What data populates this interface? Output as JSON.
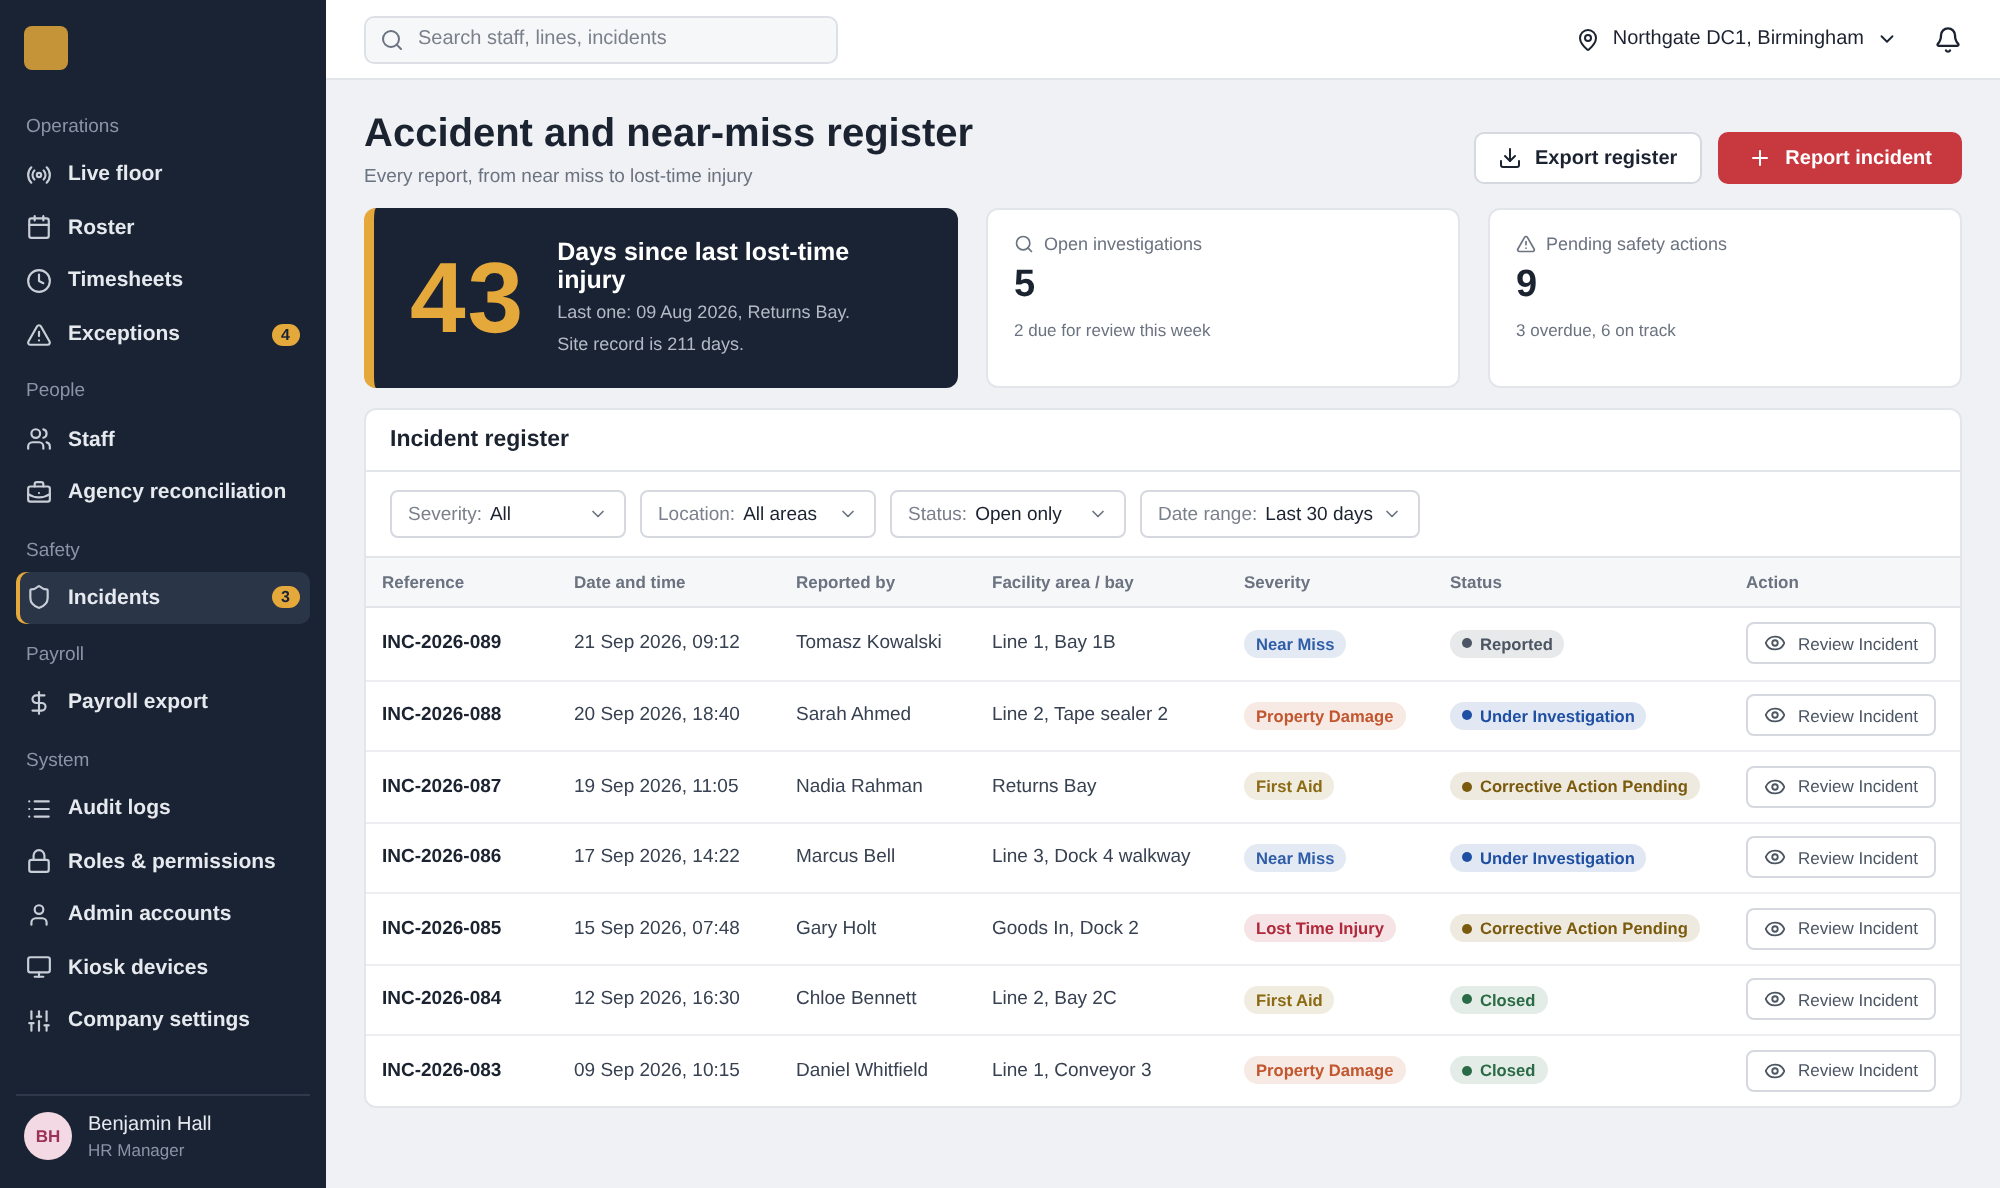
{
  "sidebar": {
    "sections": [
      {
        "title": "Operations",
        "items": [
          {
            "label": "Live floor",
            "selected": false
          },
          {
            "label": "Roster",
            "selected": false
          },
          {
            "label": "Timesheets",
            "selected": false
          },
          {
            "label": "Exceptions",
            "selected": false,
            "badge": "4"
          }
        ]
      },
      {
        "title": "People",
        "items": [
          {
            "label": "Staff",
            "selected": false
          },
          {
            "label": "Agency reconciliation",
            "selected": false
          }
        ]
      },
      {
        "title": "Safety",
        "items": [
          {
            "label": "Incidents",
            "selected": true,
            "badge": "3"
          }
        ]
      },
      {
        "title": "Payroll",
        "items": [
          {
            "label": "Payroll export",
            "selected": false
          }
        ]
      },
      {
        "title": "System",
        "items": [
          {
            "label": "Audit logs",
            "selected": false
          },
          {
            "label": "Roles & permissions",
            "selected": false
          },
          {
            "label": "Admin accounts",
            "selected": false
          },
          {
            "label": "Kiosk devices",
            "selected": false
          },
          {
            "label": "Company settings",
            "selected": false
          }
        ]
      }
    ],
    "user": {
      "initials": "BH",
      "name": "Benjamin Hall",
      "role": "HR Manager"
    }
  },
  "topbar": {
    "search": {
      "placeholder": "Search staff, lines, incidents"
    },
    "location": "Northgate DC1, Birmingham"
  },
  "header": {
    "title": "Accident and near-miss register",
    "subtitle": "Every report, from near miss to lost-time injury",
    "buttons": [
      {
        "label": "Export register",
        "kind": "secondary"
      },
      {
        "label": "Report incident",
        "kind": "primary"
      }
    ]
  },
  "hero": {
    "value": "43",
    "title": "Days since last lost-time injury",
    "lines": [
      "Last one: 09 Aug 2026, Returns Bay.",
      "Site record is 211 days."
    ]
  },
  "stats": [
    {
      "label": "Open investigations",
      "value": "5",
      "note": "2 due for review this week"
    },
    {
      "label": "Pending safety actions",
      "value": "9",
      "note": "3 overdue, 6 on track"
    }
  ],
  "register": {
    "title": "Incident register",
    "filters": [
      {
        "label": "Severity:",
        "value": "All"
      },
      {
        "label": "Location:",
        "value": "All areas"
      },
      {
        "label": "Status:",
        "value": "Open only"
      },
      {
        "label": "Date range:",
        "value": "Last 30 days"
      }
    ],
    "columns": [
      "Reference",
      "Date and time",
      "Reported by",
      "Facility area / bay",
      "Severity",
      "Status",
      "Action"
    ],
    "rows": [
      {
        "reference": "INC-2026-089",
        "datetime": "21 Sep 2026, 09:12",
        "reported_by": "Tomasz Kowalski",
        "area": "Line 1, Bay 1B",
        "severity": {
          "label": "Near Miss",
          "color": "#2f5ea8"
        },
        "status": {
          "label": "Reported",
          "color": "#4b5563"
        },
        "action": "Review Incident"
      },
      {
        "reference": "INC-2026-088",
        "datetime": "20 Sep 2026, 18:40",
        "reported_by": "Sarah Ahmed",
        "area": "Line 2, Tape sealer 2",
        "severity": {
          "label": "Property Damage",
          "color": "#c2562e"
        },
        "status": {
          "label": "Under Investigation",
          "color": "#1e4fa3"
        },
        "action": "Review Incident"
      },
      {
        "reference": "INC-2026-087",
        "datetime": "19 Sep 2026, 11:05",
        "reported_by": "Nadia Rahman",
        "area": "Returns Bay",
        "severity": {
          "label": "First Aid",
          "color": "#8a6a12"
        },
        "status": {
          "label": "Corrective Action Pending",
          "color": "#7a5a0c"
        },
        "action": "Review Incident"
      },
      {
        "reference": "INC-2026-086",
        "datetime": "17 Sep 2026, 14:22",
        "reported_by": "Marcus Bell",
        "area": "Line 3, Dock 4 walkway",
        "severity": {
          "label": "Near Miss",
          "color": "#2f5ea8"
        },
        "status": {
          "label": "Under Investigation",
          "color": "#1e4fa3"
        },
        "action": "Review Incident"
      },
      {
        "reference": "INC-2026-085",
        "datetime": "15 Sep 2026, 07:48",
        "reported_by": "Gary Holt",
        "area": "Goods In, Dock 2",
        "severity": {
          "label": "Lost Time Injury",
          "color": "#b0283a"
        },
        "status": {
          "label": "Corrective Action Pending",
          "color": "#7a5a0c"
        },
        "action": "Review Incident"
      },
      {
        "reference": "INC-2026-084",
        "datetime": "12 Sep 2026, 16:30",
        "reported_by": "Chloe Bennett",
        "area": "Line 2, Bay 2C",
        "severity": {
          "label": "First Aid",
          "color": "#8a6a12"
        },
        "status": {
          "label": "Closed",
          "color": "#2a6b45"
        },
        "action": "Review Incident"
      },
      {
        "reference": "INC-2026-083",
        "datetime": "09 Sep 2026, 10:15",
        "reported_by": "Daniel Whitfield",
        "area": "Line 1, Conveyor 3",
        "severity": {
          "label": "Property Damage",
          "color": "#c2562e"
        },
        "status": {
          "label": "Closed",
          "color": "#2a6b45"
        },
        "action": "Review Incident"
      }
    ]
  }
}
